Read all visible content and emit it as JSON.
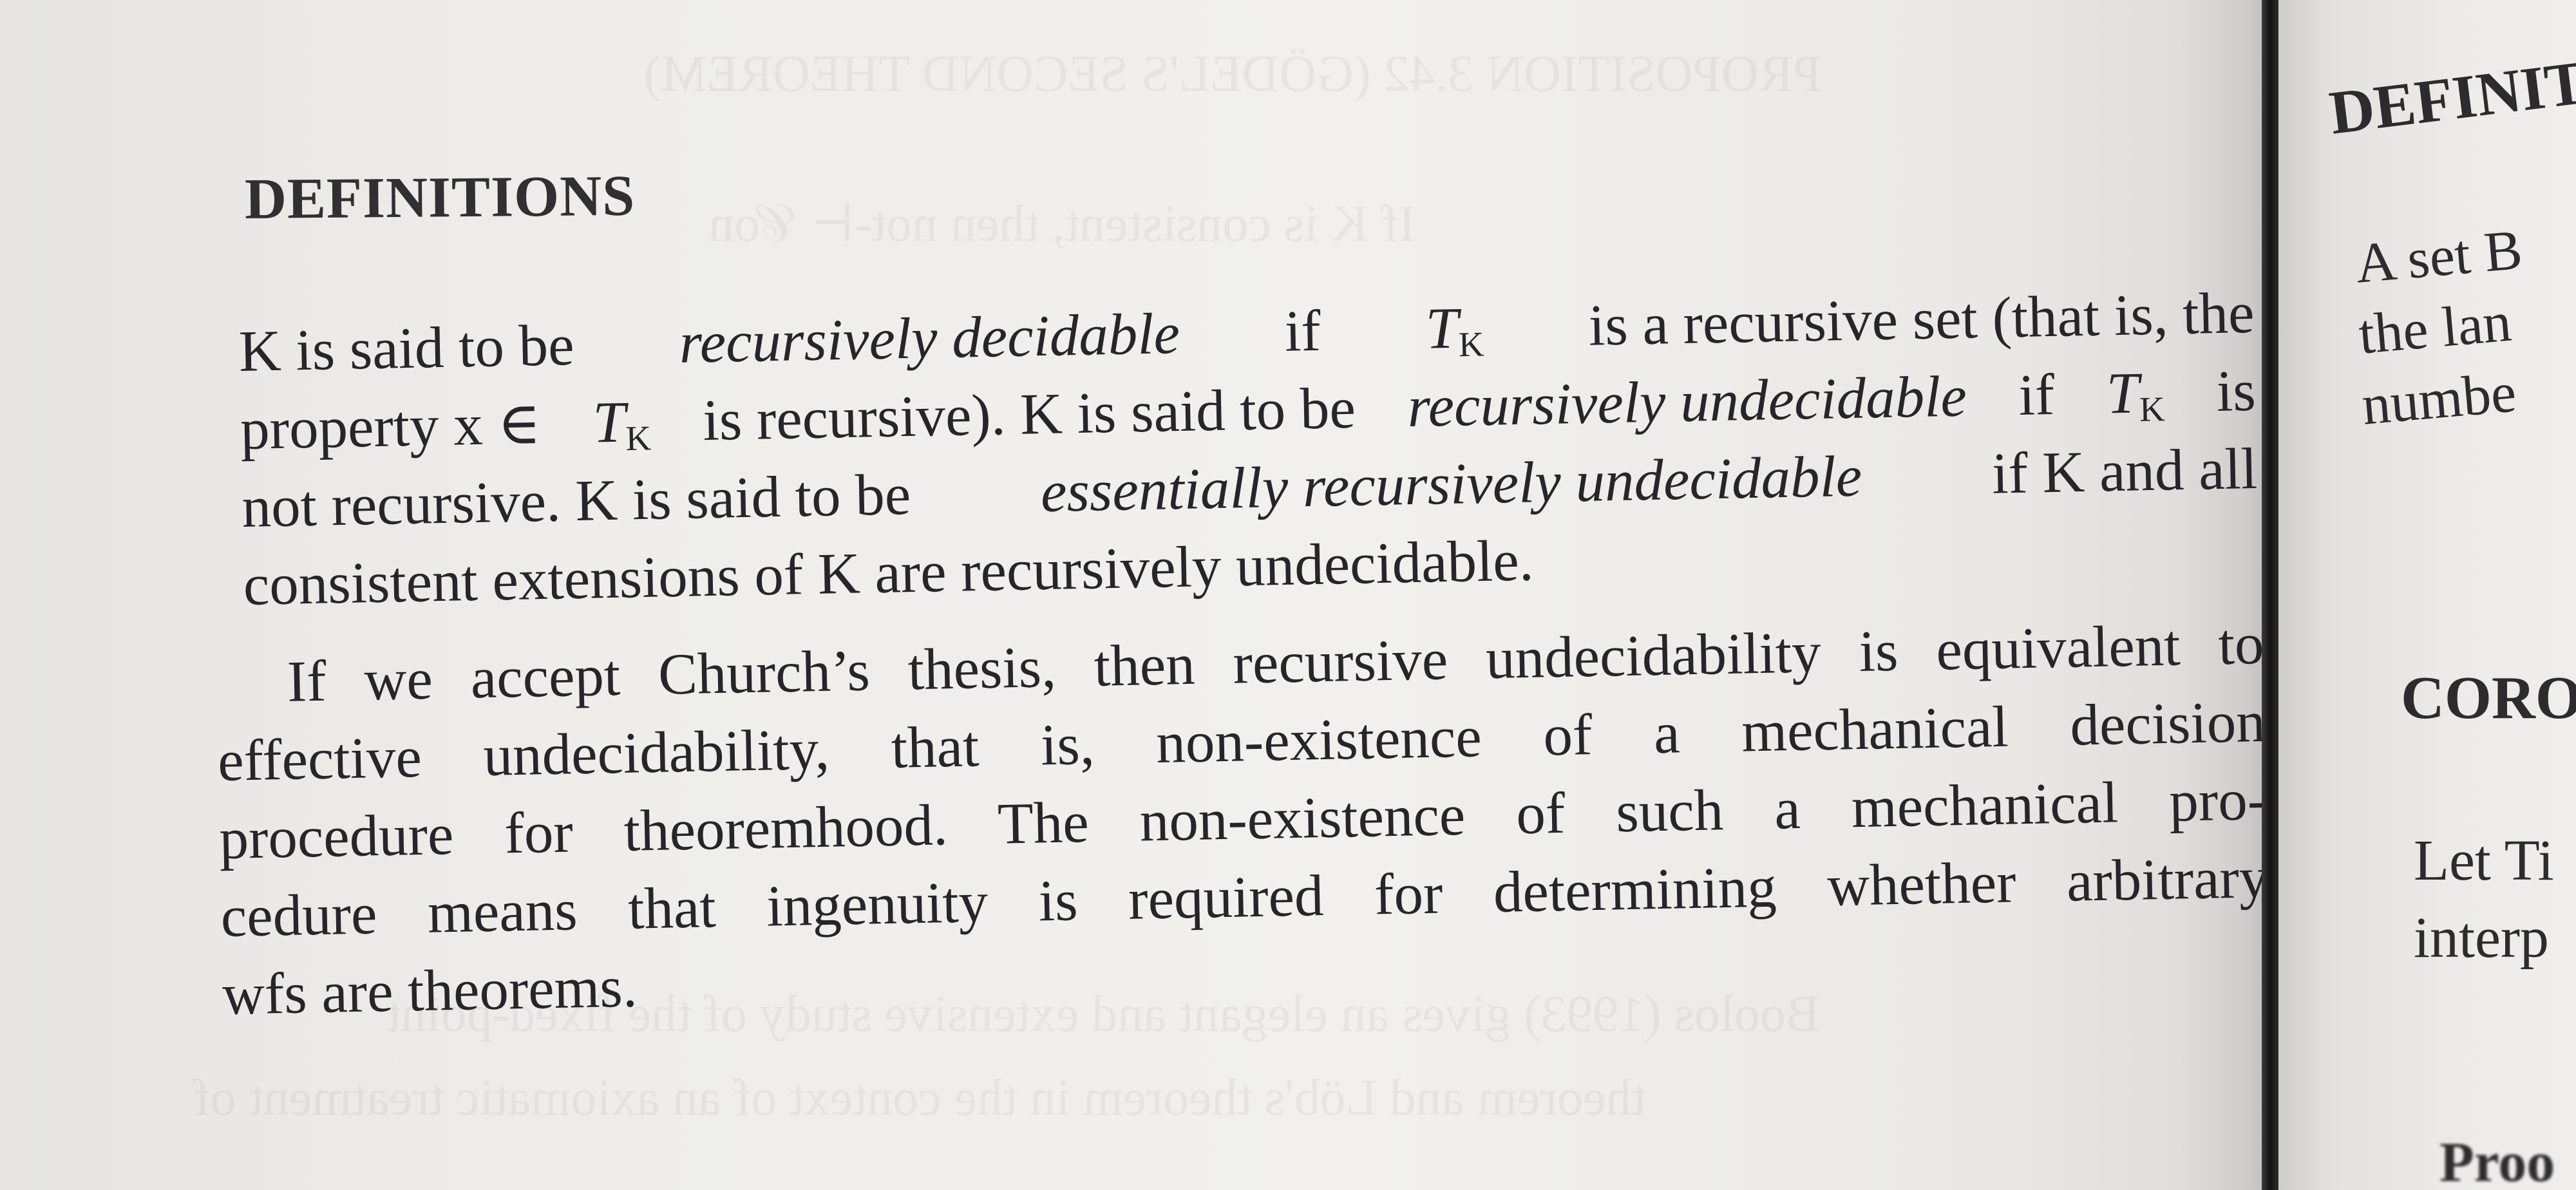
{
  "left_page": {
    "heading": "DEFINITIONS",
    "paragraph1": {
      "line1": {
        "a": "K is said to be",
        "b": "recursively decidable",
        "c": "if",
        "d": "T",
        "d_sub": "K",
        "e": "is a recursive set (that is, the"
      },
      "line2": {
        "a": "property x ∈",
        "b": "T",
        "b_sub": "K",
        "c": "is recursive). K is said to be",
        "d": "recursively undecidable",
        "e": "if",
        "f": "T",
        "f_sub": "K",
        "g": "is"
      },
      "line3": {
        "a": "not recursive. K is said to be",
        "b": "essentially recursively undecidable",
        "c": "if K and all"
      },
      "line4": "consistent extensions of K are recursively undecidable."
    },
    "paragraph2": {
      "lines": [
        "If we accept Church’s thesis, then recursive undecidability is equivalent to",
        "effective undecidability, that is, non-existence of a mechanical decision",
        "procedure for theoremhood. The non-existence of such a mechanical pro-",
        "cedure means that ingenuity is required for determining whether arbitrary",
        "wfs are theorems."
      ]
    }
  },
  "right_page": {
    "heading": "DEFINIT",
    "line1": "A set B",
    "line2": "the lan",
    "line3": "numbe",
    "heading2": "CORO",
    "line4": "Let Ti",
    "line5": "interp",
    "bottom": "Proo"
  },
  "colors": {
    "paper": "#efeeeb",
    "ink": "#26262a",
    "spine": "#141415"
  }
}
